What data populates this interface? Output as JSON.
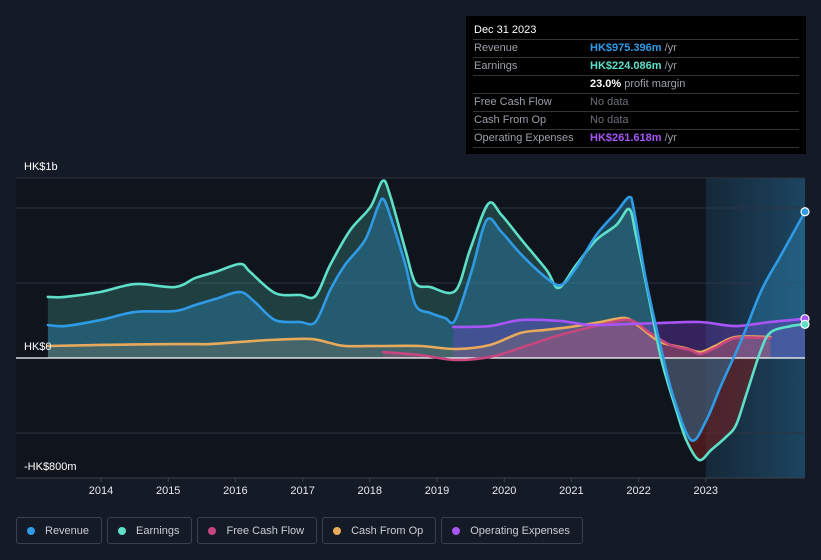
{
  "tooltip": {
    "date": "Dec 31 2023",
    "rows": [
      {
        "label": "Revenue",
        "value": "HK$975.396m",
        "unit": "/yr",
        "color": "#2f9be6"
      },
      {
        "label": "Earnings",
        "value": "HK$224.086m",
        "unit": "/yr",
        "color": "#5ee0c8"
      },
      {
        "label": "",
        "value": "23.0%",
        "unit": "profit margin",
        "color": "#ffffff"
      },
      {
        "label": "Free Cash Flow",
        "value": "No data",
        "unit": "",
        "color": "#6b7079"
      },
      {
        "label": "Cash From Op",
        "value": "No data",
        "unit": "",
        "color": "#6b7079"
      },
      {
        "label": "Operating Expenses",
        "value": "HK$261.618m",
        "unit": "/yr",
        "color": "#a855f7"
      }
    ]
  },
  "legend": [
    {
      "label": "Revenue",
      "color": "#2f9be6"
    },
    {
      "label": "Earnings",
      "color": "#5ee0c8"
    },
    {
      "label": "Free Cash Flow",
      "color": "#c8467f"
    },
    {
      "label": "Cash From Op",
      "color": "#e8a95b"
    },
    {
      "label": "Operating Expenses",
      "color": "#a855f7"
    }
  ],
  "chart_data": {
    "type": "area",
    "title": "",
    "xlabel": "",
    "ylabel": "",
    "y_unit": "HK$ millions",
    "ylim": [
      -800,
      1200
    ],
    "y_tick_labels": [
      {
        "value": 1000,
        "label": "HK$1b"
      },
      {
        "value": 0,
        "label": "HK$0"
      },
      {
        "value": -800,
        "label": "-HK$800m"
      }
    ],
    "y_gridlines": [
      1200,
      1000,
      500,
      0,
      -500,
      -800
    ],
    "xlim": [
      2013.2,
      2024.0
    ],
    "x_ticks": [
      2014,
      2015,
      2016,
      2017,
      2018,
      2019,
      2020,
      2021,
      2022,
      2023
    ],
    "forecast_shade_from": 2023.0,
    "grid": true,
    "legend_position": "bottom",
    "series": [
      {
        "name": "Revenue",
        "color": "#2f9be6",
        "points": [
          [
            2013.21,
            220
          ],
          [
            2013.46,
            213
          ],
          [
            2013.99,
            253
          ],
          [
            2014.51,
            307
          ],
          [
            2015.1,
            313
          ],
          [
            2015.4,
            353
          ],
          [
            2015.7,
            393
          ],
          [
            2016.07,
            440
          ],
          [
            2016.29,
            373
          ],
          [
            2016.59,
            253
          ],
          [
            2016.96,
            240
          ],
          [
            2017.19,
            240
          ],
          [
            2017.41,
            453
          ],
          [
            2017.63,
            620
          ],
          [
            2017.93,
            787
          ],
          [
            2018.12,
            1007
          ],
          [
            2018.2,
            1060
          ],
          [
            2018.3,
            953
          ],
          [
            2018.53,
            620
          ],
          [
            2018.68,
            353
          ],
          [
            2018.9,
            300
          ],
          [
            2019.12,
            267
          ],
          [
            2019.27,
            253
          ],
          [
            2019.52,
            587
          ],
          [
            2019.74,
            920
          ],
          [
            2019.96,
            840
          ],
          [
            2020.26,
            687
          ],
          [
            2020.63,
            533
          ],
          [
            2020.85,
            487
          ],
          [
            2021.07,
            600
          ],
          [
            2021.37,
            820
          ],
          [
            2021.67,
            973
          ],
          [
            2021.86,
            1073
          ],
          [
            2021.93,
            987
          ],
          [
            2022.11,
            520
          ],
          [
            2022.34,
            53
          ],
          [
            2022.51,
            -247
          ],
          [
            2022.78,
            -547
          ],
          [
            2023.01,
            -413
          ],
          [
            2023.23,
            -180
          ],
          [
            2023.53,
            120
          ],
          [
            2023.83,
            453
          ],
          [
            2024.12,
            687
          ],
          [
            2024.5,
            975
          ]
        ]
      },
      {
        "name": "Earnings",
        "color": "#5ee0c8",
        "points": [
          [
            2013.21,
            407
          ],
          [
            2013.46,
            407
          ],
          [
            2013.99,
            440
          ],
          [
            2014.51,
            493
          ],
          [
            2015.1,
            473
          ],
          [
            2015.4,
            533
          ],
          [
            2015.7,
            573
          ],
          [
            2016.07,
            627
          ],
          [
            2016.22,
            573
          ],
          [
            2016.59,
            433
          ],
          [
            2016.96,
            420
          ],
          [
            2017.19,
            413
          ],
          [
            2017.41,
            620
          ],
          [
            2017.71,
            853
          ],
          [
            2018.01,
            1007
          ],
          [
            2018.19,
            1180
          ],
          [
            2018.3,
            1087
          ],
          [
            2018.53,
            720
          ],
          [
            2018.68,
            500
          ],
          [
            2018.9,
            473
          ],
          [
            2019.27,
            447
          ],
          [
            2019.49,
            720
          ],
          [
            2019.76,
            1027
          ],
          [
            2019.96,
            953
          ],
          [
            2020.26,
            787
          ],
          [
            2020.63,
            587
          ],
          [
            2020.81,
            467
          ],
          [
            2021.07,
            620
          ],
          [
            2021.37,
            787
          ],
          [
            2021.67,
            887
          ],
          [
            2021.86,
            993
          ],
          [
            2021.96,
            820
          ],
          [
            2022.16,
            387
          ],
          [
            2022.34,
            -13
          ],
          [
            2022.56,
            -347
          ],
          [
            2022.71,
            -547
          ],
          [
            2022.9,
            -680
          ],
          [
            2023.08,
            -613
          ],
          [
            2023.3,
            -527
          ],
          [
            2023.45,
            -447
          ],
          [
            2023.6,
            -247
          ],
          [
            2023.82,
            53
          ],
          [
            2023.97,
            173
          ],
          [
            2024.27,
            213
          ],
          [
            2024.5,
            224
          ]
        ]
      },
      {
        "name": "Free Cash Flow",
        "color": "#c8467f",
        "points": [
          [
            2018.2,
            40
          ],
          [
            2018.75,
            20
          ],
          [
            2019.27,
            -13
          ],
          [
            2019.79,
            7
          ],
          [
            2020.24,
            67
          ],
          [
            2020.83,
            153
          ],
          [
            2021.43,
            220
          ],
          [
            2021.87,
            253
          ],
          [
            2022.17,
            167
          ],
          [
            2022.47,
            87
          ],
          [
            2022.77,
            53
          ],
          [
            2022.92,
            27
          ],
          [
            2023.14,
            67
          ],
          [
            2023.44,
            133
          ],
          [
            2023.96,
            133
          ]
        ]
      },
      {
        "name": "Cash From Op",
        "color": "#e8a95b",
        "points": [
          [
            2013.21,
            80
          ],
          [
            2013.99,
            87
          ],
          [
            2015.1,
            93
          ],
          [
            2015.62,
            93
          ],
          [
            2016.07,
            107
          ],
          [
            2016.51,
            120
          ],
          [
            2017.11,
            127
          ],
          [
            2017.41,
            100
          ],
          [
            2017.63,
            80
          ],
          [
            2018.15,
            80
          ],
          [
            2018.75,
            80
          ],
          [
            2019.27,
            60
          ],
          [
            2019.79,
            87
          ],
          [
            2020.24,
            167
          ],
          [
            2020.61,
            187
          ],
          [
            2020.98,
            207
          ],
          [
            2021.43,
            240
          ],
          [
            2021.8,
            267
          ],
          [
            2022.02,
            207
          ],
          [
            2022.32,
            107
          ],
          [
            2022.69,
            67
          ],
          [
            2022.92,
            40
          ],
          [
            2023.14,
            80
          ],
          [
            2023.44,
            140
          ],
          [
            2023.96,
            140
          ]
        ]
      },
      {
        "name": "Operating Expenses",
        "color": "#a855f7",
        "points": [
          [
            2019.24,
            207
          ],
          [
            2019.79,
            213
          ],
          [
            2020.24,
            253
          ],
          [
            2020.83,
            247
          ],
          [
            2021.28,
            220
          ],
          [
            2021.87,
            227
          ],
          [
            2022.32,
            233
          ],
          [
            2022.92,
            240
          ],
          [
            2023.44,
            213
          ],
          [
            2023.96,
            240
          ],
          [
            2024.5,
            262
          ]
        ]
      }
    ]
  }
}
